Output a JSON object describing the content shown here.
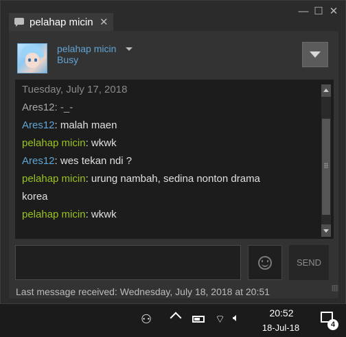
{
  "window": {
    "controls": {
      "minimize": "—",
      "maximize": "☐",
      "close": "✕"
    }
  },
  "tab": {
    "title": "pelahap micin",
    "close": "✕",
    "icon": "chat-bubble-icon"
  },
  "friend": {
    "name": "pelahap micin",
    "status": "Busy"
  },
  "log": {
    "date": "Tuesday, July 17, 2018",
    "messages": [
      {
        "sender": "Ares12",
        "text": ": -_-",
        "style": "grey"
      },
      {
        "sender": "Ares12",
        "text": ": malah maen",
        "style": "blue"
      },
      {
        "sender": "pelahap micin",
        "text": ": wkwk",
        "style": "green"
      },
      {
        "sender": "Ares12",
        "text": ": wes tekan ndi ?",
        "style": "blue"
      },
      {
        "sender": "pelahap micin",
        "text": ": urung nambah, sedina nonton drama",
        "style": "green"
      },
      {
        "sender": "",
        "text": "korea",
        "style": "cont"
      },
      {
        "sender": "pelahap micin",
        "text": ": wkwk",
        "style": "green"
      }
    ]
  },
  "composer": {
    "send_label": "SEND",
    "emote_icon": "emoticon-icon"
  },
  "status": {
    "last_message": "Last message received: Wednesday, July 18, 2018 at 20:51"
  },
  "taskbar": {
    "time": "20:52",
    "date": "18-Jul-18",
    "notification_count": "4"
  },
  "colors": {
    "sender_blue": "#62a5d4",
    "sender_green": "#9ac31e"
  }
}
